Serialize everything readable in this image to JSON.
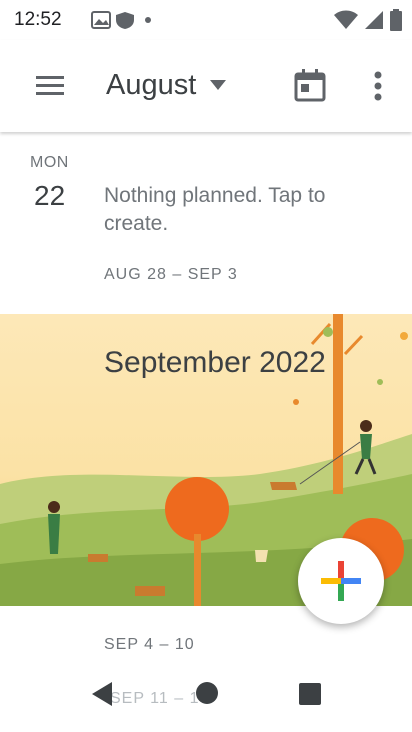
{
  "status_bar": {
    "time": "12:52",
    "left_icons": [
      "photos-icon",
      "shield-icon",
      "dot-icon"
    ],
    "right_icons": [
      "wifi-icon",
      "cell-signal-icon",
      "battery-icon"
    ]
  },
  "app_bar": {
    "month_label": "August",
    "icons": [
      "menu-icon",
      "dropdown-caret-icon",
      "today-calendar-icon",
      "more-vert-icon"
    ]
  },
  "day": {
    "weekday": "MON",
    "date": "22",
    "empty_text": "Nothing planned. Tap to create."
  },
  "weeks": {
    "week1": "AUG 28 – SEP 3",
    "week2": "SEP 4 – 10",
    "week3_peek": "SEP 11 – 1"
  },
  "banner": {
    "title": "September 2022"
  },
  "fab": {
    "icon": "create-plus-icon"
  },
  "nav": {
    "icons": [
      "back-icon",
      "home-icon",
      "recents-icon"
    ]
  },
  "colors": {
    "accent_red": "#ea4335",
    "accent_blue": "#4285f4",
    "accent_green": "#34a853",
    "accent_yellow": "#fbbc04",
    "text": "#3c4043",
    "secondary_text": "#70757a"
  }
}
